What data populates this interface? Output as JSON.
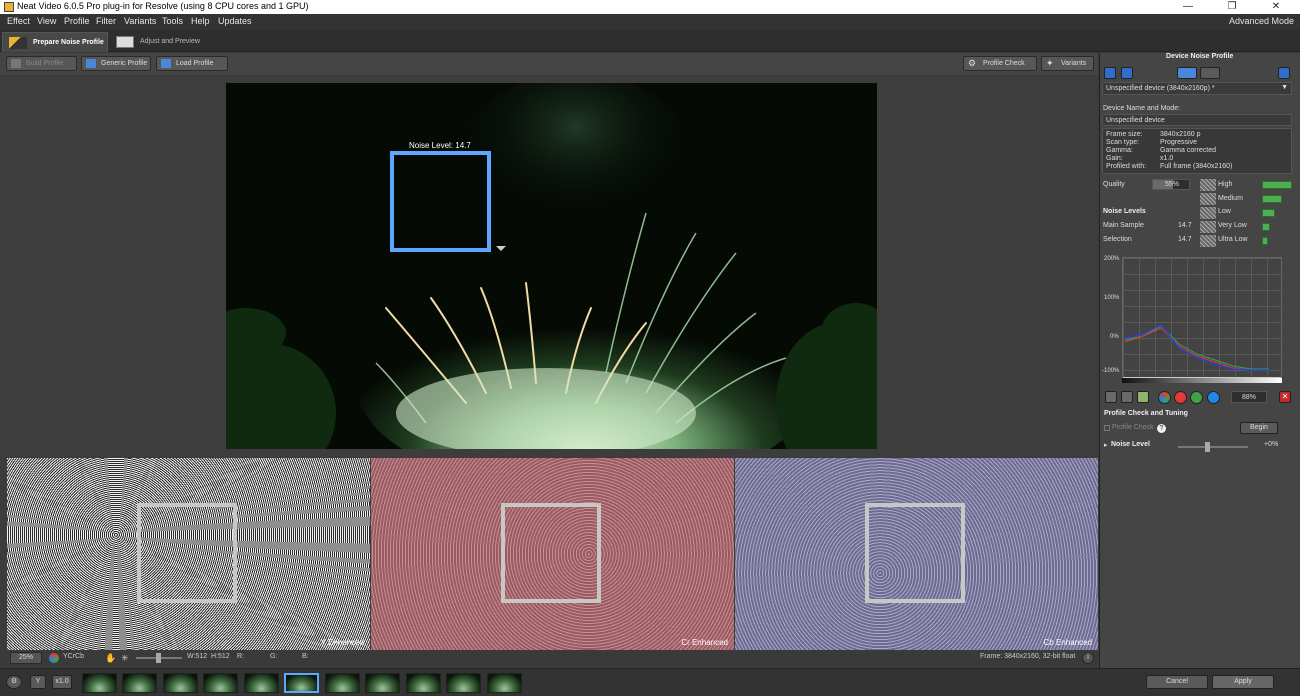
{
  "window": {
    "title": "Neat Video 6.0.5 Pro plug-in for Resolve (using 8 CPU cores and 1 GPU)",
    "mode": "Advanced Mode"
  },
  "menu": [
    "Effect",
    "View",
    "Profile",
    "Filter",
    "Variants",
    "Tools",
    "Help",
    "Updates"
  ],
  "tabs": {
    "prepare": "Prepare Noise Profile",
    "adjust": "Adjust and Preview"
  },
  "toolbar": {
    "build": "Build Profile",
    "generic": "Generic Profile",
    "load": "Load Profile",
    "check": "Profile Check",
    "variants": "Variants"
  },
  "viewer": {
    "noise_level": "Noise Level: 14.7"
  },
  "channels": {
    "y": "Y Enhanced",
    "cr": "Cr Enhanced",
    "cb": "Cb Enhanced"
  },
  "bottombar": {
    "zoom": "25%",
    "colorspace": "YCrCb",
    "w": "W:512",
    "h": "H:512",
    "r": "R:",
    "g": "G:",
    "b": "B:",
    "frame": "Frame: 3840x2160, 32-bit float"
  },
  "filmstrip": {
    "scale": "x1.0",
    "selected": 5,
    "count": 11
  },
  "actions": {
    "cancel": "Cancel",
    "apply": "Apply"
  },
  "panel": {
    "title": "Device Noise Profile",
    "device": "Unspecified device (3840x2160p) *",
    "name_label": "Device Name and Mode:",
    "name_value": "Unspecified device",
    "info": [
      {
        "k": "Frame size:",
        "v": "3840x2160 p"
      },
      {
        "k": "Scan type:",
        "v": "Progressive"
      },
      {
        "k": "Gamma:",
        "v": "Gamma corrected"
      },
      {
        "k": "Gain:",
        "v": "x1.0"
      },
      {
        "k": "Profiled with:",
        "v": "Full frame (3840x2160)"
      }
    ],
    "quality_label": "Quality",
    "quality_value": "55%",
    "noise_levels_title": "Noise Levels",
    "main_sample_label": "Main Sample",
    "main_sample_value": "14.7",
    "selection_label": "Selection",
    "selection_value": "14.7",
    "freq_levels": [
      {
        "name": "High",
        "fill": 1.0
      },
      {
        "name": "Medium",
        "fill": 0.68
      },
      {
        "name": "Low",
        "fill": 0.42
      },
      {
        "name": "Very Low",
        "fill": 0.25
      },
      {
        "name": "Ultra Low",
        "fill": 0.18
      }
    ],
    "graph_ticks": [
      "200%",
      "100%",
      "0%",
      "-100%"
    ],
    "graph_pct": "88%",
    "check_title": "Profile Check and Tuning",
    "check_label": "Profile Check",
    "begin": "Begin",
    "noise_level_label": "Noise Level",
    "noise_level_value": "+0%"
  }
}
